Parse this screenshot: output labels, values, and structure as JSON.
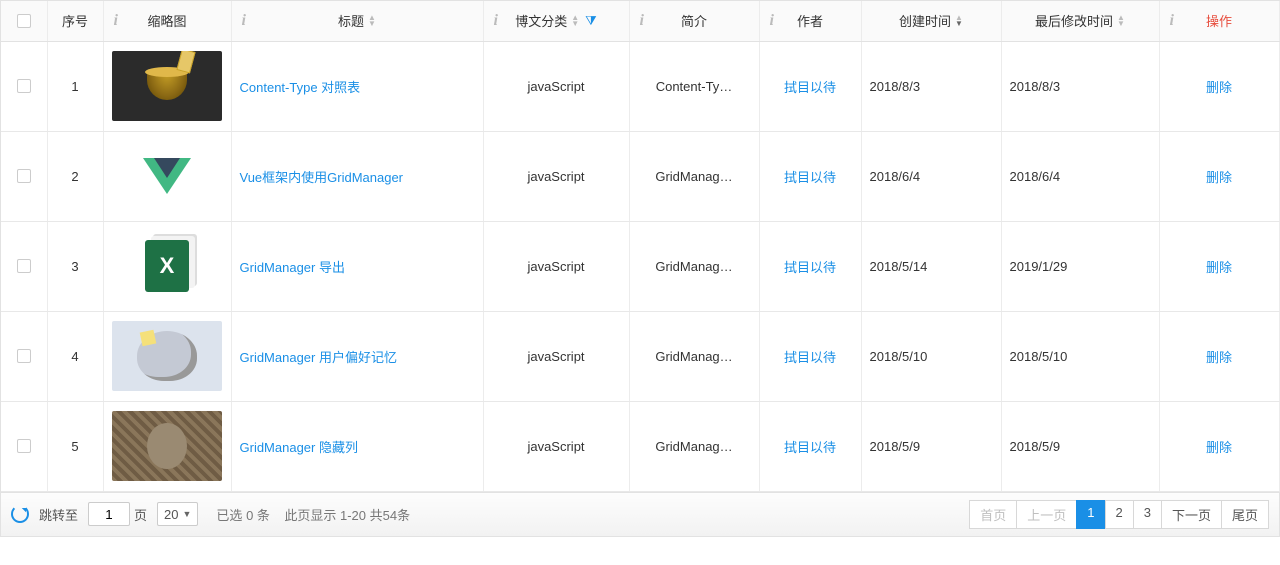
{
  "columns": {
    "index": "序号",
    "thumb": "缩略图",
    "title": "标题",
    "category": "博文分类",
    "intro": "简介",
    "author": "作者",
    "created": "创建时间",
    "modified": "最后修改时间",
    "action": "操作"
  },
  "action_label": "删除",
  "rows": [
    {
      "index": "1",
      "title": "Content-Type 对照表",
      "category": "javaScript",
      "intro": "Content-Ty…",
      "author": "拭目以待",
      "created": "2018/8/3",
      "modified": "2018/8/3"
    },
    {
      "index": "2",
      "title": "Vue框架内使用GridManager",
      "category": "javaScript",
      "intro": "GridManag…",
      "author": "拭目以待",
      "created": "2018/6/4",
      "modified": "2018/6/4"
    },
    {
      "index": "3",
      "title": "GridManager 导出",
      "category": "javaScript",
      "intro": "GridManag…",
      "author": "拭目以待",
      "created": "2018/5/14",
      "modified": "2019/1/29"
    },
    {
      "index": "4",
      "title": "GridManager 用户偏好记忆",
      "category": "javaScript",
      "intro": "GridManag…",
      "author": "拭目以待",
      "created": "2018/5/10",
      "modified": "2018/5/10"
    },
    {
      "index": "5",
      "title": "GridManager 隐藏列",
      "category": "javaScript",
      "intro": "GridManag…",
      "author": "拭目以待",
      "created": "2018/5/9",
      "modified": "2018/5/9"
    }
  ],
  "footer": {
    "jump_label": "跳转至",
    "page_unit": "页",
    "current_page": "1",
    "page_size": "20",
    "selected_prefix": "已选",
    "selected_count": "0",
    "selected_suffix": "条",
    "range_text": "此页显示 1-20 共54条",
    "first": "首页",
    "prev": "上一页",
    "pages": [
      "1",
      "2",
      "3"
    ],
    "active_page": "1",
    "next": "下一页",
    "last": "尾页"
  }
}
